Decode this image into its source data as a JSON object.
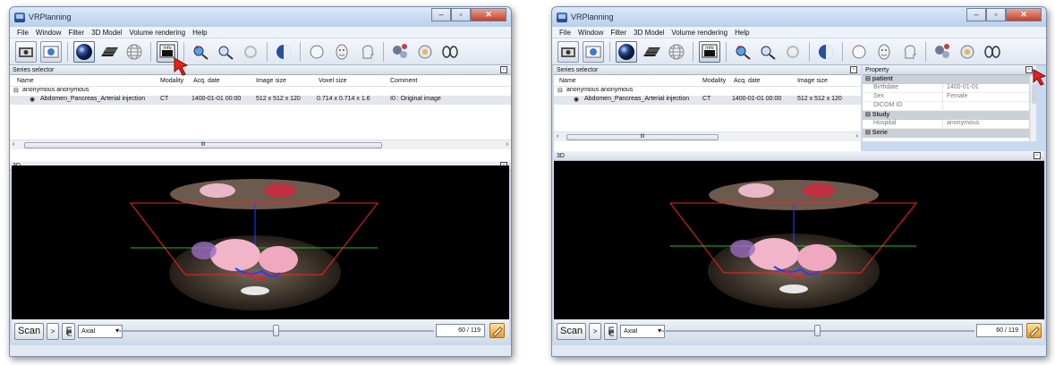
{
  "app_title": "VRPlanning",
  "menu": [
    "File",
    "Window",
    "Filter",
    "3D Model",
    "Volume rendering",
    "Help"
  ],
  "toolbar": {
    "info_label": "info"
  },
  "series_panel": {
    "title": "Series selector",
    "columns_left": [
      "Name",
      "Modality",
      "Acq. date",
      "Image size",
      "Voxel size",
      "Comment"
    ],
    "columns_right": [
      "Name",
      "Modality",
      "Acq. date",
      "Image size"
    ],
    "patient": "anonymous anonymous",
    "series": {
      "name": "Abdomen_Pancreas_Arterial injection",
      "modality": "CT",
      "acq_date": "1400-01-01 00:00",
      "image_size": "512  x 512 x 120",
      "voxel_size": "0.714 x 0.714 x 1.6",
      "comment": "I0 : Original image"
    },
    "scroll_label": "III"
  },
  "property_panel": {
    "title": "Property",
    "rows": [
      {
        "type": "cat",
        "label": "patient"
      },
      {
        "type": "kv",
        "key": "Birthdate",
        "value": "1400-01-01"
      },
      {
        "type": "kv",
        "key": "Sex",
        "value": "Female"
      },
      {
        "type": "kv",
        "key": "DICOM ID",
        "value": ""
      },
      {
        "type": "cat",
        "label": "Study"
      },
      {
        "type": "kv",
        "key": "Hospital",
        "value": "anonymous"
      },
      {
        "type": "cat",
        "label": "Serie"
      }
    ]
  },
  "view3d": {
    "title": "3D"
  },
  "bottom": {
    "scan_label": "Scan",
    "arrow_label": ">",
    "orientation": "Axial",
    "slice_counter": "60 / 119",
    "slice_position": 0.5
  },
  "colors": {
    "window_frame": "#c9d9ee",
    "pointer": "#e8201a",
    "plane_red": "#ff2020",
    "plane_green": "#20c020",
    "axis_blue": "#2040ff"
  }
}
